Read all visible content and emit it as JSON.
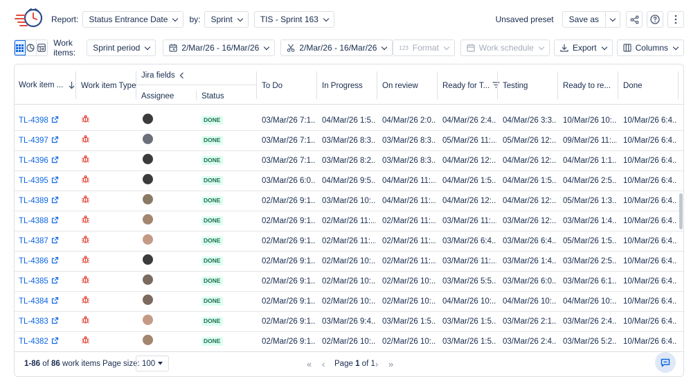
{
  "toolbar": {
    "report_label": "Report:",
    "report_value": "Status Entrance Date",
    "by_label": "by:",
    "by_value": "Sprint",
    "sprint_value": "TIS - Sprint 163",
    "unsaved_preset": "Unsaved preset",
    "save_as": "Save as"
  },
  "filters": {
    "work_items_label": "Work items:",
    "work_items_value": "Sprint period",
    "date_range_1": "2/Mar/26 - 16/Mar/26",
    "date_range_2": "2/Mar/26 - 16/Mar/26",
    "format": "Format",
    "format_prefix": "123",
    "work_schedule": "Work schedule",
    "export": "Export",
    "columns": "Columns"
  },
  "table": {
    "headers": {
      "work_item": "Work item ...",
      "work_item_type": "Work item Type",
      "jira_fields": "Jira fields",
      "assignee": "Assignee",
      "status": "Status",
      "todo": "To Do",
      "in_progress": "In Progress",
      "on_review": "On review",
      "ready_for": "Ready for T...",
      "testing": "Testing",
      "ready_to": "Ready to re...",
      "done": "Done"
    },
    "rows": [
      {
        "key": "TL-4398",
        "status": "DONE",
        "todo": "03/Mar/26 7:1...",
        "inprogress": "04/Mar/26 1:5...",
        "onreview": "04/Mar/26 2:0...",
        "readyfor": "04/Mar/26 2:4...",
        "testing": "04/Mar/26 3:3...",
        "readyto": "10/Mar/26 10:...",
        "done": "10/Mar/26 6:4...",
        "avatar_color": "#3b3b3b"
      },
      {
        "key": "TL-4397",
        "status": "DONE",
        "todo": "03/Mar/26 7:1...",
        "inprogress": "03/Mar/26 8:3...",
        "onreview": "03/Mar/26 8:3...",
        "readyfor": "05/Mar/26 11:...",
        "testing": "05/Mar/26 12:...",
        "readyto": "09/Mar/26 11:...",
        "done": "10/Mar/26 6:4...",
        "avatar_color": "#6b6f7a"
      },
      {
        "key": "TL-4396",
        "status": "DONE",
        "todo": "03/Mar/26 7:1...",
        "inprogress": "03/Mar/26 8:2...",
        "onreview": "03/Mar/26 8:3...",
        "readyfor": "04/Mar/26 12:...",
        "testing": "04/Mar/26 12:...",
        "readyto": "04/Mar/26 1:1...",
        "done": "10/Mar/26 6:4...",
        "avatar_color": "#3b3b3b"
      },
      {
        "key": "TL-4395",
        "status": "DONE",
        "todo": "03/Mar/26 6:0...",
        "inprogress": "04/Mar/26 9:5...",
        "onreview": "04/Mar/26 11:...",
        "readyfor": "04/Mar/26 1:5...",
        "testing": "04/Mar/26 1:5...",
        "readyto": "04/Mar/26 2:5...",
        "done": "10/Mar/26 6:4...",
        "avatar_color": "#3b3b3b"
      },
      {
        "key": "TL-4389",
        "status": "DONE",
        "todo": "02/Mar/26 9:1...",
        "inprogress": "03/Mar/26 10:...",
        "onreview": "04/Mar/26 11:...",
        "readyfor": "04/Mar/26 12:...",
        "testing": "04/Mar/26 12:...",
        "readyto": "05/Mar/26 1:3...",
        "done": "10/Mar/26 6:4...",
        "avatar_color": "#8a7a64"
      },
      {
        "key": "TL-4388",
        "status": "DONE",
        "todo": "02/Mar/26 9:1...",
        "inprogress": "02/Mar/26 11:...",
        "onreview": "02/Mar/26 11:...",
        "readyfor": "03/Mar/26 11:...",
        "testing": "03/Mar/26 12:...",
        "readyto": "03/Mar/26 1:4...",
        "done": "10/Mar/26 6:4...",
        "avatar_color": "#a4856e"
      },
      {
        "key": "TL-4387",
        "status": "DONE",
        "todo": "02/Mar/26 9:1...",
        "inprogress": "02/Mar/26 11:...",
        "onreview": "02/Mar/26 11:...",
        "readyfor": "03/Mar/26 6:4...",
        "testing": "03/Mar/26 6:4...",
        "readyto": "05/Mar/26 1:5...",
        "done": "10/Mar/26 6:4...",
        "avatar_color": "#c49a86"
      },
      {
        "key": "TL-4386",
        "status": "DONE",
        "todo": "02/Mar/26 9:1...",
        "inprogress": "02/Mar/26 10:...",
        "onreview": "02/Mar/26 11:...",
        "readyfor": "03/Mar/26 11:...",
        "testing": "03/Mar/26 1:4...",
        "readyto": "03/Mar/26 2:5...",
        "done": "10/Mar/26 6:4...",
        "avatar_color": "#3b3b3b"
      },
      {
        "key": "TL-4385",
        "status": "DONE",
        "todo": "02/Mar/26 9:1...",
        "inprogress": "02/Mar/26 10:...",
        "onreview": "02/Mar/26 10:...",
        "readyfor": "03/Mar/26 5:5...",
        "testing": "03/Mar/26 6:0...",
        "readyto": "03/Mar/26 6:1...",
        "done": "10/Mar/26 6:4...",
        "avatar_color": "#7b6a5e"
      },
      {
        "key": "TL-4384",
        "status": "DONE",
        "todo": "02/Mar/26 9:1...",
        "inprogress": "02/Mar/26 10:...",
        "onreview": "02/Mar/26 10:...",
        "readyfor": "04/Mar/26 10:...",
        "testing": "04/Mar/26 10:...",
        "readyto": "04/Mar/26 10:...",
        "done": "10/Mar/26 6:4...",
        "avatar_color": "#7b6a5e"
      },
      {
        "key": "TL-4383",
        "status": "DONE",
        "todo": "02/Mar/26 9:1...",
        "inprogress": "03/Mar/26 9:4...",
        "onreview": "03/Mar/26 1:5...",
        "readyfor": "03/Mar/26 1:5...",
        "testing": "03/Mar/26 2:1...",
        "readyto": "03/Mar/26 2:4...",
        "done": "10/Mar/26 6:4...",
        "avatar_color": "#c49a86"
      },
      {
        "key": "TL-4382",
        "status": "DONE",
        "todo": "02/Mar/26 9:1...",
        "inprogress": "02/Mar/26 10:...",
        "onreview": "02/Mar/26 10:...",
        "readyfor": "03/Mar/26 1:5...",
        "testing": "03/Mar/26 2:4...",
        "readyto": "03/Mar/26 5:2...",
        "done": "10/Mar/26 6:4...",
        "avatar_color": "#a4856e"
      }
    ]
  },
  "footer": {
    "range": "1-86",
    "of": "of",
    "total": "86",
    "items_label": "work items",
    "page_size_label": "Page size:",
    "page_size_value": "100",
    "page_label": "Page",
    "page_current": "1",
    "page_of": "of",
    "page_total": "1"
  },
  "colors": {
    "link": "#0c66e4",
    "bug": "#e2483d",
    "done_bg": "#dcfff1",
    "done_text": "#216e4e",
    "active_view": "#0c66e4"
  },
  "icons": [
    "app-logo-icon",
    "chevron-down-icon",
    "share-icon",
    "help-icon",
    "more-vertical-icon",
    "grid-view-icon",
    "pie-chart-icon",
    "table-chart-icon",
    "calendar-icon",
    "scissors-icon",
    "calendar-schedule-icon",
    "download-icon",
    "columns-icon",
    "sort-down-icon",
    "collapse-left-icon",
    "filter-icon",
    "external-link-icon",
    "bug-icon",
    "chat-icon",
    "first-page-icon",
    "prev-page-icon",
    "next-page-icon",
    "last-page-icon"
  ]
}
